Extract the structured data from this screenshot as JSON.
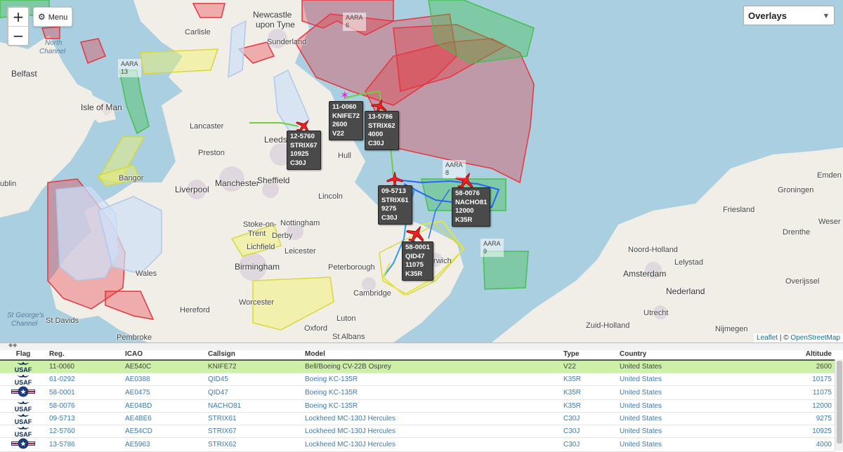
{
  "map": {
    "zoom_in": "+",
    "zoom_out": "−",
    "menu_label": "Menu",
    "overlays_label": "Overlays",
    "attribution": {
      "leaflet": "Leaflet",
      "sep": " | © ",
      "osm": "OpenStreetMap"
    },
    "places": [
      {
        "t": "Newcastle",
        "c": "big"
      },
      {
        "t": "upon Tyne",
        "c": "big"
      },
      {
        "t": "Sunderland",
        "c": ""
      },
      {
        "t": "Carlisle",
        "c": ""
      },
      {
        "t": "Belfast",
        "c": "big"
      },
      {
        "t": "Isle of Man",
        "c": "big"
      },
      {
        "t": "Lancaster",
        "c": ""
      },
      {
        "t": "Leeds",
        "c": "big"
      },
      {
        "t": "Preston",
        "c": ""
      },
      {
        "t": "Hull",
        "c": ""
      },
      {
        "t": "Manchester",
        "c": "big"
      },
      {
        "t": "Sheffield",
        "c": "big"
      },
      {
        "t": "Liverpool",
        "c": "big"
      },
      {
        "t": "Lincoln",
        "c": ""
      },
      {
        "t": "Stoke-on-",
        "c": ""
      },
      {
        "t": "Trent",
        "c": ""
      },
      {
        "t": "Nottingham",
        "c": ""
      },
      {
        "t": "Derby",
        "c": ""
      },
      {
        "t": "Lichfield",
        "c": ""
      },
      {
        "t": "Leicester",
        "c": ""
      },
      {
        "t": "Birmingham",
        "c": "big"
      },
      {
        "t": "Peterborough",
        "c": ""
      },
      {
        "t": "Norwich",
        "c": ""
      },
      {
        "t": "Cambridge",
        "c": ""
      },
      {
        "t": "Wales",
        "c": ""
      },
      {
        "t": "Hereford",
        "c": ""
      },
      {
        "t": "Worcester",
        "c": ""
      },
      {
        "t": "St Davids",
        "c": ""
      },
      {
        "t": "Oxford",
        "c": ""
      },
      {
        "t": "St Albans",
        "c": ""
      },
      {
        "t": "Luton",
        "c": ""
      },
      {
        "t": "Bangor",
        "c": ""
      },
      {
        "t": "Amsterdam",
        "c": "big"
      },
      {
        "t": "Nederland",
        "c": "big"
      },
      {
        "t": "Utrecht",
        "c": ""
      },
      {
        "t": "Nijmegen",
        "c": ""
      },
      {
        "t": "Groningen",
        "c": ""
      },
      {
        "t": "Friesland",
        "c": ""
      },
      {
        "t": "Drenthe",
        "c": ""
      },
      {
        "t": "Overijssel",
        "c": ""
      },
      {
        "t": "Noord-Holland",
        "c": ""
      },
      {
        "t": "Zuid-Holland",
        "c": ""
      },
      {
        "t": "Lelystad",
        "c": ""
      },
      {
        "t": "Emden",
        "c": ""
      },
      {
        "t": "North",
        "c": "sea"
      },
      {
        "t": "Channel",
        "c": "sea"
      },
      {
        "t": "St George's",
        "c": "sea"
      },
      {
        "t": "Channel",
        "c": "sea"
      },
      {
        "t": "ublin",
        "c": ""
      },
      {
        "t": "Pembroke",
        "c": ""
      },
      {
        "t": "Weser",
        "c": ""
      }
    ],
    "aara": [
      {
        "t": "AARA",
        "n": "6"
      },
      {
        "t": "AARA",
        "n": "13"
      },
      {
        "t": "AARA",
        "n": "8"
      },
      {
        "t": "AARA",
        "n": "9"
      }
    ],
    "aircraft_labels": [
      {
        "reg": "11-0060",
        "cs": "KNIFE72",
        "alt": "2600",
        "type": "V22"
      },
      {
        "reg": "13-5786",
        "cs": "STRIX62",
        "alt": "4000",
        "type": "C30J"
      },
      {
        "reg": "12-5760",
        "cs": "STRIX67",
        "alt": "10925",
        "type": "C30J"
      },
      {
        "reg": "09-5713",
        "cs": "STRIX61",
        "alt": "9275",
        "type": "C30J"
      },
      {
        "reg": "58-0076",
        "cs": "NACHO81",
        "alt": "12000",
        "type": "K35R"
      },
      {
        "reg": "58-0001",
        "cs": "QID47",
        "alt": "11075",
        "type": "K35R"
      }
    ],
    "colors": {
      "sea": "#a9cfe0",
      "land": "#f1eee8",
      "red_zone": "#e8343b",
      "green_zone": "#44c050",
      "yellow_zone": "#f2f266",
      "blue_zone": "#cfe0f8"
    }
  },
  "table": {
    "headers": {
      "flag": "Flag",
      "reg": "Reg.",
      "icao": "ICAO",
      "callsign": "Callsign",
      "model": "Model",
      "type": "Type",
      "country": "Country",
      "altitude": "Altitude"
    },
    "flag_label": "USAF",
    "rows": [
      {
        "flag": "usaf-wings",
        "reg": "11-0060",
        "icao": "AE540C",
        "callsign": "KNIFE72",
        "model": "Bell/Boeing CV-22B Osprey",
        "type": "V22",
        "country": "United States",
        "alt": "2600",
        "selected": true
      },
      {
        "flag": "usaf-wings",
        "reg": "61-0292",
        "icao": "AE0388",
        "callsign": "QID45",
        "model": "Boeing KC-135R",
        "type": "K35R",
        "country": "United States",
        "alt": "10175",
        "selected": false
      },
      {
        "flag": "usaf-roundel",
        "reg": "58-0001",
        "icao": "AE0475",
        "callsign": "QID47",
        "model": "Boeing KC-135R",
        "type": "K35R",
        "country": "United States",
        "alt": "11075",
        "selected": false
      },
      {
        "flag": "usaf-wings",
        "reg": "58-0076",
        "icao": "AE04BD",
        "callsign": "NACHO81",
        "model": "Boeing KC-135R",
        "type": "K35R",
        "country": "United States",
        "alt": "12000",
        "selected": false
      },
      {
        "flag": "usaf-wings",
        "reg": "09-5713",
        "icao": "AE4BE6",
        "callsign": "STRIX61",
        "model": "Lockheed MC-130J Hercules",
        "type": "C30J",
        "country": "United States",
        "alt": "9275",
        "selected": false
      },
      {
        "flag": "usaf-wings",
        "reg": "12-5760",
        "icao": "AE54CD",
        "callsign": "STRIX67",
        "model": "Lockheed MC-130J Hercules",
        "type": "C30J",
        "country": "United States",
        "alt": "10925",
        "selected": false
      },
      {
        "flag": "usaf-roundel",
        "reg": "13-5786",
        "icao": "AE5963",
        "callsign": "STRIX62",
        "model": "Lockheed MC-130J Hercules",
        "type": "C30J",
        "country": "United States",
        "alt": "4000",
        "selected": false
      }
    ]
  }
}
